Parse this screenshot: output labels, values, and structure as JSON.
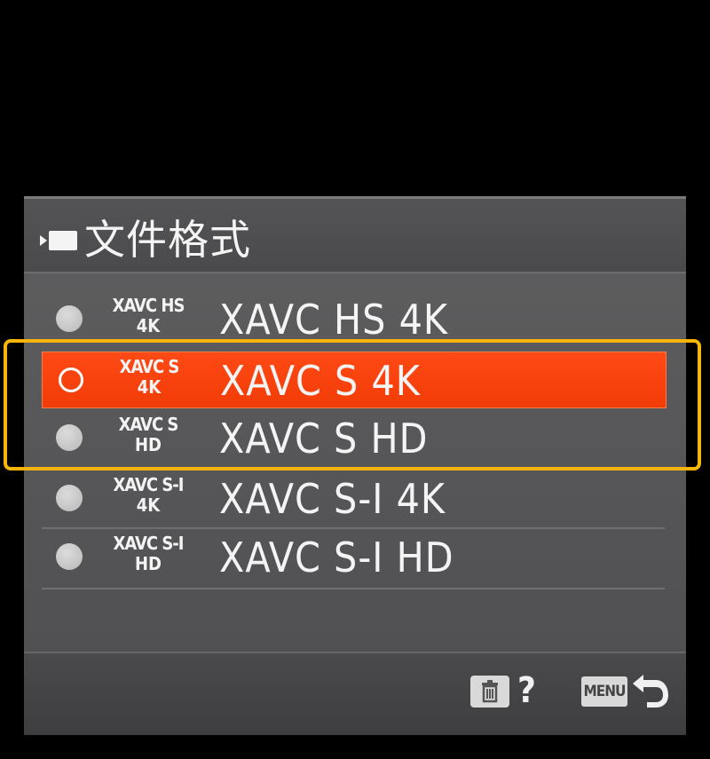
{
  "header": {
    "title": "文件格式",
    "icon": "movie-mode-icon"
  },
  "options": [
    {
      "badge_line1": "XAVC HS",
      "badge_line2": "4K",
      "label": "XAVC HS 4K",
      "selected": false
    },
    {
      "badge_line1": "XAVC S",
      "badge_line2": "4K",
      "label": "XAVC S 4K",
      "selected": true
    },
    {
      "badge_line1": "XAVC S",
      "badge_line2": "HD",
      "label": "XAVC S HD",
      "selected": false
    },
    {
      "badge_line1": "XAVC S-I",
      "badge_line2": "4K",
      "label": "XAVC S-I 4K",
      "selected": false
    },
    {
      "badge_line1": "XAVC S-I",
      "badge_line2": "HD",
      "label": "XAVC S-I HD",
      "selected": false
    }
  ],
  "footer": {
    "delete_icon": "trash-icon",
    "help_mark": "?",
    "menu_label": "MENU",
    "back_icon": "return-arrow-icon"
  },
  "colors": {
    "selected_row": "#f23c08",
    "highlight_frame": "#f5b50a",
    "screen_bg": "#58585a"
  }
}
